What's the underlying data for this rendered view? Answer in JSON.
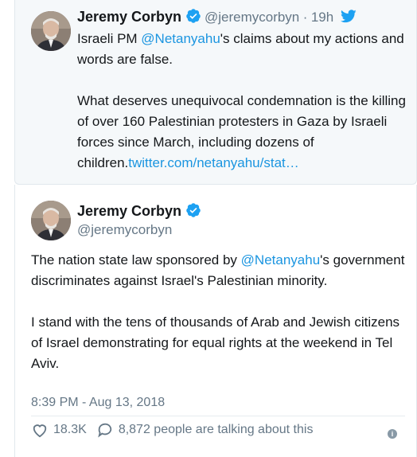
{
  "quoted_tweet": {
    "name": "Jeremy Corbyn",
    "handle": "@jeremycorbyn",
    "separator": "·",
    "time": "19h",
    "text_parts": {
      "p1_before": "Israeli PM ",
      "p1_link": "@Netanyahu",
      "p1_after": "'s claims about my actions and words are false.",
      "p2_before": "What deserves unequivocal condemnation is the killing of over 160 Palestinian protesters in Gaza by Israeli forces since March, including dozens of children.",
      "p2_link": "twitter.com/netanyahu/stat…"
    }
  },
  "main_tweet": {
    "name": "Jeremy Corbyn",
    "handle": "@jeremycorbyn",
    "text_parts": {
      "p1_before": "The nation state law sponsored by ",
      "p1_link": "@Netanyahu",
      "p1_after": "'s government discriminates against Israel's Palestinian minority.",
      "p2": "I stand with the tens of thousands of Arab and Jewish citizens of Israel demonstrating for equal rights at the weekend in Tel Aviv."
    },
    "timestamp": "8:39 PM - Aug 13, 2018",
    "likes": "18.3K",
    "talking": "8,872 people are talking about this"
  },
  "colors": {
    "link": "#1b95e0",
    "verified": "#1da1f2",
    "secondary_text": "#657786",
    "quoted_bg": "#f5f8fa"
  },
  "icons": {
    "verified": "verified-badge-icon",
    "bird": "twitter-bird-icon",
    "like": "heart-icon",
    "reply": "speech-bubble-icon",
    "info": "info-icon"
  }
}
